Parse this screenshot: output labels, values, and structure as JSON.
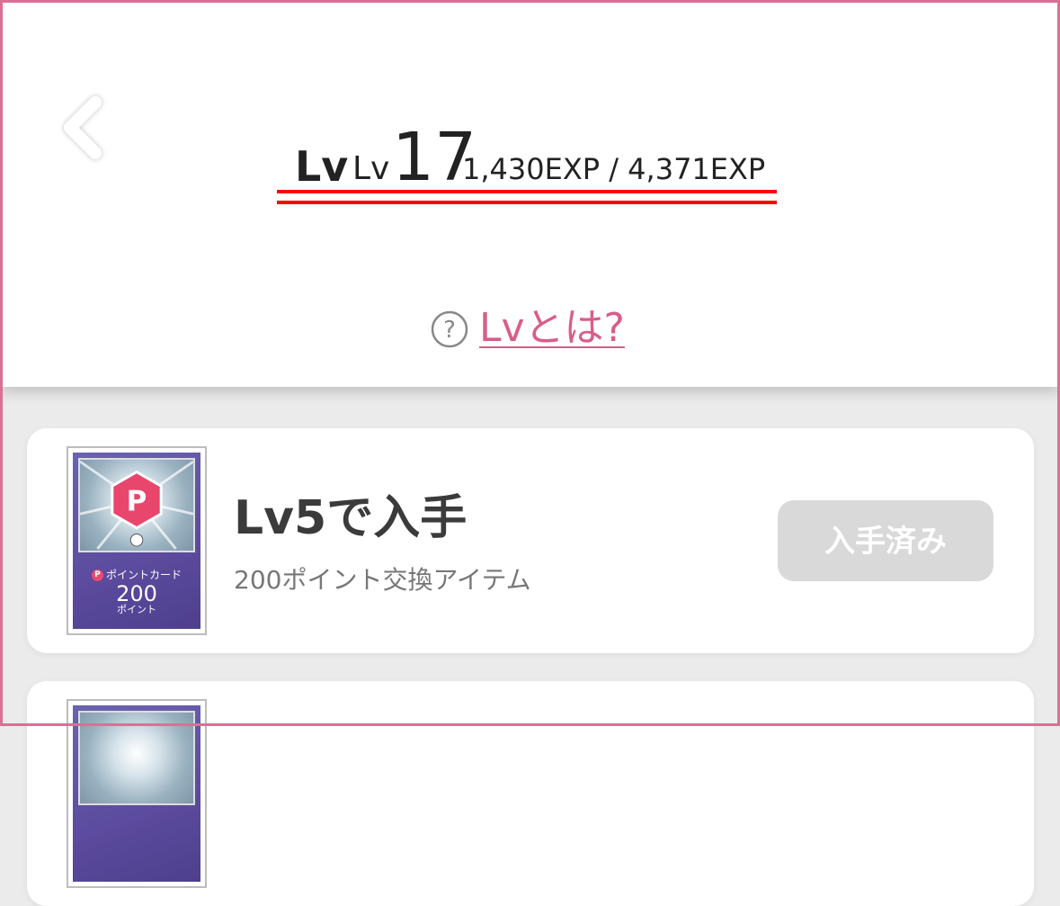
{
  "header": {
    "level_label": "Lv",
    "level_prefix": "Lv",
    "level_number": "17",
    "exp_text": "1,430EXP / 4,371EXP",
    "help_icon_text": "?",
    "help_link": "Lvとは?"
  },
  "rewards": [
    {
      "title": "Lv5で入手",
      "subtitle": "200ポイント交換アイテム",
      "button_label": "入手済み",
      "card_label": "ポイントカード",
      "card_badge": "P",
      "card_amount": "200",
      "card_unit": "ポイント"
    }
  ],
  "colors": {
    "accent": "#d85d8a",
    "frame": "#dc6f93",
    "underline": "#ff0000",
    "disabled_button": "#d9d9d9",
    "badge": "#e94b6e"
  }
}
